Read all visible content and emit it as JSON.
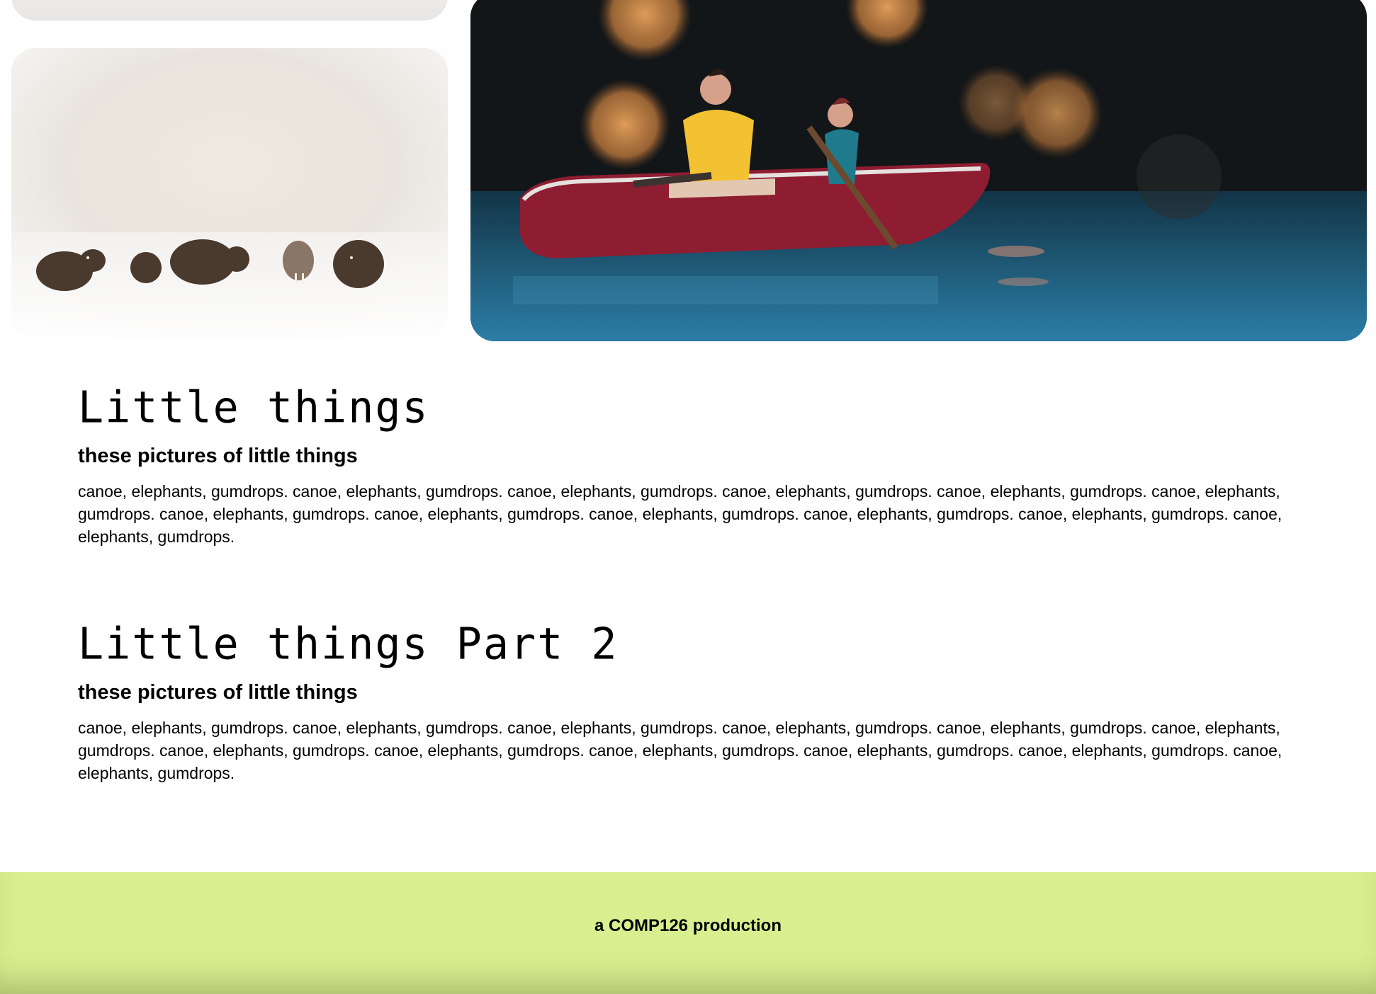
{
  "images": [
    {
      "alt": "partial image",
      "name": "top-partial-photo"
    },
    {
      "alt": "small wooden elephants on white fur",
      "name": "elephants-photo"
    },
    {
      "alt": "miniature figures paddling a red canoe",
      "name": "canoe-photo"
    }
  ],
  "sections": [
    {
      "title": "Little things",
      "subtitle": "these pictures of little things",
      "body": "canoe, elephants, gumdrops. canoe, elephants, gumdrops. canoe, elephants, gumdrops. canoe, elephants, gumdrops. canoe, elephants, gumdrops. canoe, elephants, gumdrops. canoe, elephants, gumdrops. canoe, elephants, gumdrops. canoe, elephants, gumdrops. canoe, elephants, gumdrops. canoe, elephants, gumdrops. canoe, elephants, gumdrops."
    },
    {
      "title": "Little things Part 2",
      "subtitle": "these pictures of little things",
      "body": "canoe, elephants, gumdrops. canoe, elephants, gumdrops. canoe, elephants, gumdrops. canoe, elephants, gumdrops. canoe, elephants, gumdrops. canoe, elephants, gumdrops. canoe, elephants, gumdrops. canoe, elephants, gumdrops. canoe, elephants, gumdrops. canoe, elephants, gumdrops. canoe, elephants, gumdrops. canoe, elephants, gumdrops."
    }
  ],
  "footer": {
    "text": "a COMP126 production"
  },
  "colors": {
    "footer_background": "#d8ef8f",
    "text": "#000000",
    "page_background": "#ffffff"
  }
}
